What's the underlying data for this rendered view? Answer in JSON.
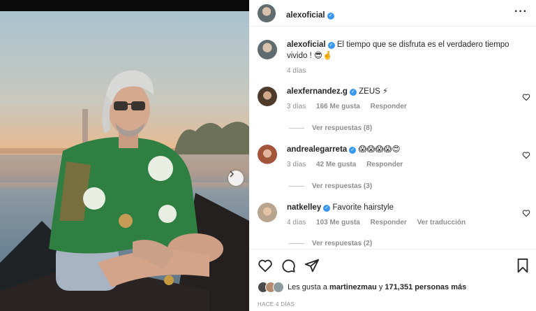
{
  "post": {
    "author": "alexoficial",
    "verified": true,
    "caption": "El tiempo que se disfruta es el verdadero tiempo vivido ! 😎🤞",
    "caption_time": "4 días"
  },
  "comments": [
    {
      "username": "alexfernandez.g",
      "text": "ZEUS ⚡",
      "time": "3 días",
      "likes": "166 Me gusta",
      "reply": "Responder",
      "translate": "",
      "replies": "Ver respuestas (8)"
    },
    {
      "username": "andrealegarreta",
      "text": "😱😱😱😱😍",
      "time": "3 días",
      "likes": "42 Me gusta",
      "reply": "Responder",
      "translate": "",
      "replies": "Ver respuestas (3)"
    },
    {
      "username": "natkelley",
      "text": "Favorite hairstyle",
      "time": "4 días",
      "likes": "103 Me gusta",
      "reply": "Responder",
      "translate": "Ver traducción",
      "replies": "Ver respuestas (2)"
    }
  ],
  "likes": {
    "prefix": "Les gusta a",
    "user": "martinezmau",
    "connector": "y",
    "count": "171,351 personas más"
  },
  "posted_ago": "HACE 4 DÍAS",
  "icons": [
    "more-options-icon",
    "verified-icon",
    "heart-icon",
    "comment-icon",
    "share-icon",
    "bookmark-icon",
    "next-arrow-icon"
  ],
  "colors": {
    "verified": "#3897f0",
    "muted": "#8e8e8e",
    "text": "#262626"
  }
}
